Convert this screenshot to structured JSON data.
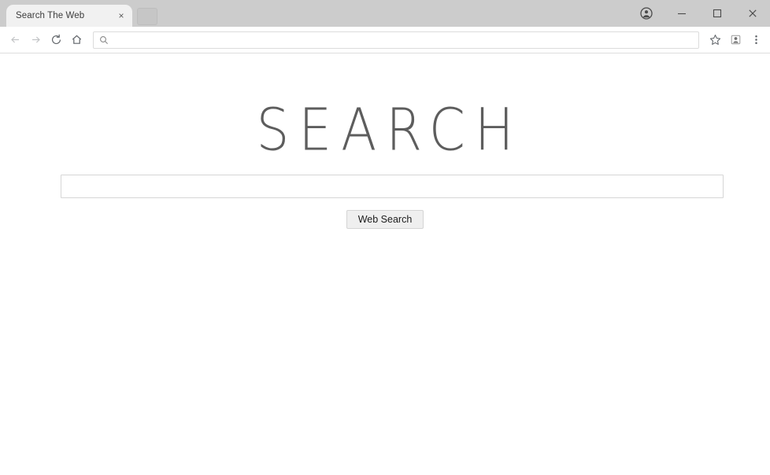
{
  "browser": {
    "tab": {
      "title": "Search The Web",
      "close_label": "×",
      "close_icon": "close-icon"
    },
    "new_tab_label": "",
    "window_controls": {
      "profile_icon": "profile-avatar-icon",
      "minimize_label": "–",
      "maximize_label": "□",
      "close_label": "✕"
    },
    "navigation": {
      "back_icon": "arrow-left-icon",
      "forward_icon": "arrow-right-icon",
      "reload_icon": "reload-icon",
      "home_icon": "home-icon"
    },
    "omnibox": {
      "value": "",
      "placeholder": "",
      "leading_icon": "magnifier-icon"
    },
    "toolbar_icons": {
      "bookmark_icon": "star-icon",
      "extension_icon": "extension-avatar-icon",
      "menu_icon": "three-dot-menu-icon"
    }
  },
  "page": {
    "heading": "SEARCH",
    "search_field": {
      "value": "",
      "placeholder": ""
    },
    "search_button_label": "Web Search"
  },
  "colors": {
    "tab_strip_bg": "#cccccc",
    "tab_bg": "#f1f1f1",
    "toolbar_bg": "#ffffff",
    "page_bg": "#ffffff",
    "heading_color": "#5d5d5d",
    "input_border": "#d6d6d6",
    "button_bg": "#efefef",
    "button_border": "#d4d4d4"
  }
}
